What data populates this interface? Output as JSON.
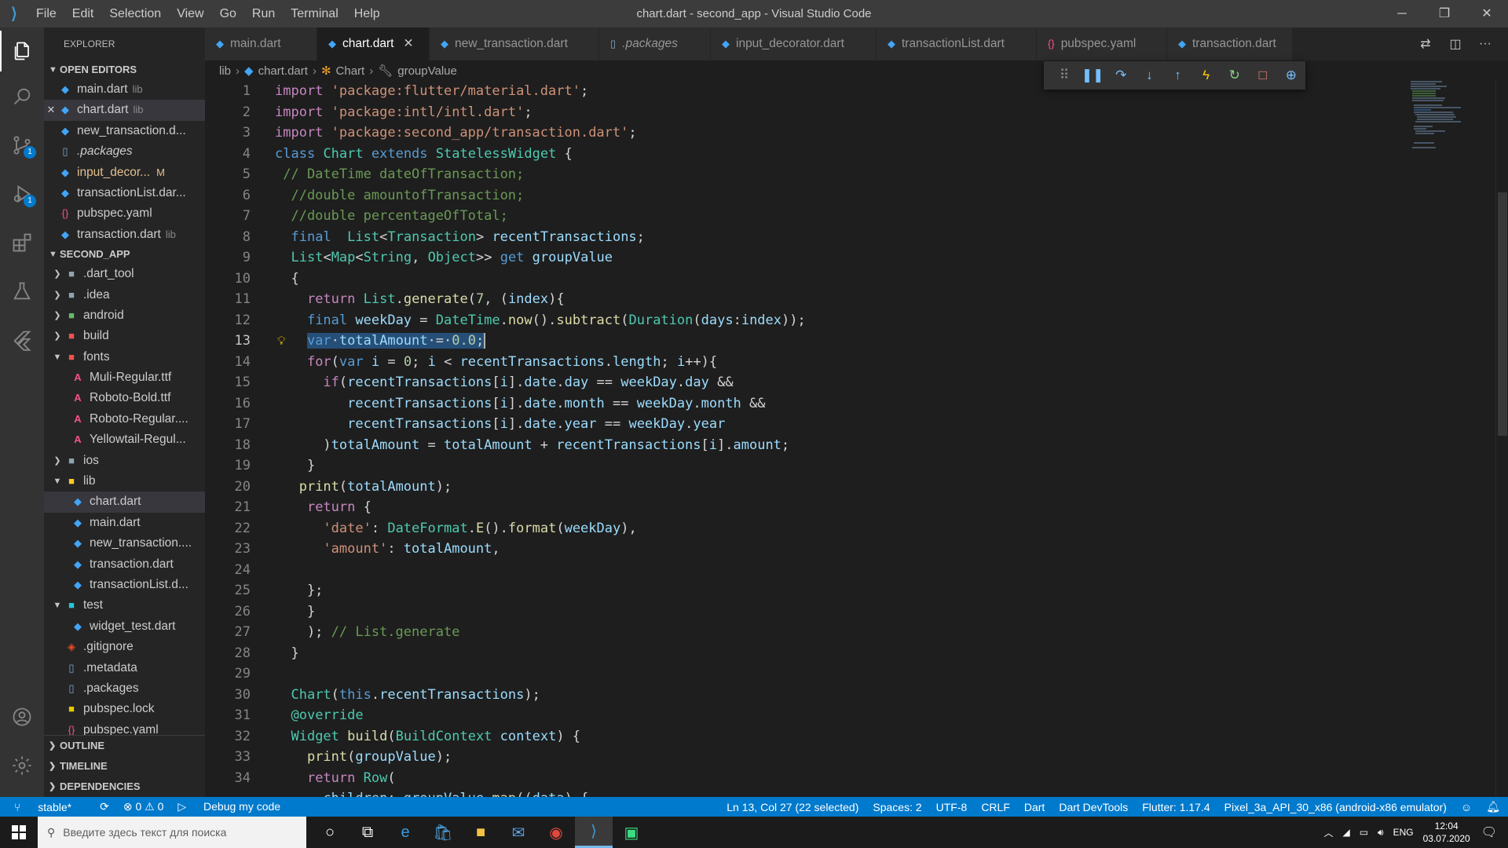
{
  "window": {
    "title": "chart.dart - second_app - Visual Studio Code",
    "menu": [
      "File",
      "Edit",
      "Selection",
      "View",
      "Go",
      "Run",
      "Terminal",
      "Help"
    ]
  },
  "activity": {
    "explorer_icon": "files-icon",
    "search_icon": "search-icon",
    "scm_icon": "source-control-icon",
    "scm_badge": "1",
    "debug_icon": "run-debug-icon",
    "debug_badge": "1",
    "extensions_icon": "extensions-icon",
    "testing_icon": "flask-icon",
    "flutter_icon": "flutter-icon",
    "accounts_icon": "account-icon",
    "settings_icon": "gear-icon"
  },
  "sidebar": {
    "title": "EXPLORER",
    "open_editors": {
      "label": "OPEN EDITORS",
      "items": [
        {
          "name": "main.dart",
          "note": "lib",
          "mod": ""
        },
        {
          "name": "chart.dart",
          "note": "lib",
          "mod": ""
        },
        {
          "name": "new_transaction.d...",
          "note": "",
          "mod": ""
        },
        {
          "name": ".packages",
          "note": "",
          "mod": ""
        },
        {
          "name": "input_decor...",
          "note": "",
          "mod": "M"
        },
        {
          "name": "transactionList.dar...",
          "note": "",
          "mod": ""
        },
        {
          "name": "pubspec.yaml",
          "note": "",
          "mod": ""
        },
        {
          "name": "transaction.dart",
          "note": "lib",
          "mod": ""
        }
      ]
    },
    "project": {
      "label": "SECOND_APP",
      "items": [
        ".dart_tool",
        ".idea",
        "android",
        "build",
        "fonts",
        "Muli-Regular.ttf",
        "Roboto-Bold.ttf",
        "Roboto-Regular....",
        "Yellowtail-Regul...",
        "ios",
        "lib",
        "chart.dart",
        "main.dart",
        "new_transaction....",
        "transaction.dart",
        "transactionList.d...",
        "test",
        "widget_test.dart",
        ".gitignore",
        ".metadata",
        ".packages",
        "pubspec.lock",
        "pubspec.yaml"
      ]
    },
    "outline": "OUTLINE",
    "timeline": "TIMELINE",
    "dependencies": "DEPENDENCIES"
  },
  "tabs": [
    {
      "label": "main.dart"
    },
    {
      "label": "chart.dart"
    },
    {
      "label": "new_transaction.dart"
    },
    {
      "label": ".packages"
    },
    {
      "label": "input_decorator.dart"
    },
    {
      "label": "transactionList.dart"
    },
    {
      "label": "pubspec.yaml"
    },
    {
      "label": "transaction.dart"
    }
  ],
  "breadcrumb": {
    "folder": "lib",
    "file": "chart.dart",
    "class": "Chart",
    "member": "groupValue"
  },
  "debug_toolbar": {
    "icons": [
      "drag-grip-icon",
      "pause-icon",
      "step-over-icon",
      "step-into-icon",
      "step-out-icon",
      "hot-reload-icon",
      "restart-icon",
      "stop-icon",
      "devtools-icon"
    ]
  },
  "editor": {
    "line_numbers": [
      "1",
      "2",
      "3",
      "4",
      "5",
      "6",
      "7",
      "8",
      "9",
      "10",
      "11",
      "12",
      "13",
      "14",
      "15",
      "16",
      "17",
      "18",
      "19",
      "20",
      "21",
      "22",
      "23",
      "24",
      "25",
      "26",
      "27",
      "28",
      "29",
      "30",
      "31",
      "32",
      "33",
      "34"
    ]
  },
  "statusbar": {
    "branch": "stable*",
    "sync": "⟳",
    "problems": "⊗ 0 ⚠ 0",
    "debug_config": "Debug my code",
    "cursor": "Ln 13, Col 27 (22 selected)",
    "spaces": "Spaces: 2",
    "encoding": "UTF-8",
    "eol": "CRLF",
    "language": "Dart",
    "devtools": "Dart DevTools",
    "flutter": "Flutter: 1.17.4",
    "device": "Pixel_3a_API_30_x86 (android-x86 emulator)"
  },
  "taskbar": {
    "search_placeholder": "Введите здесь текст для поиска",
    "language": "ENG",
    "time": "12:04",
    "date": "03.07.2020"
  },
  "colors": {
    "accent": "#007acc",
    "editor_bg": "#1e1e1e",
    "sidebar_bg": "#252526",
    "selection": "#264f78"
  }
}
